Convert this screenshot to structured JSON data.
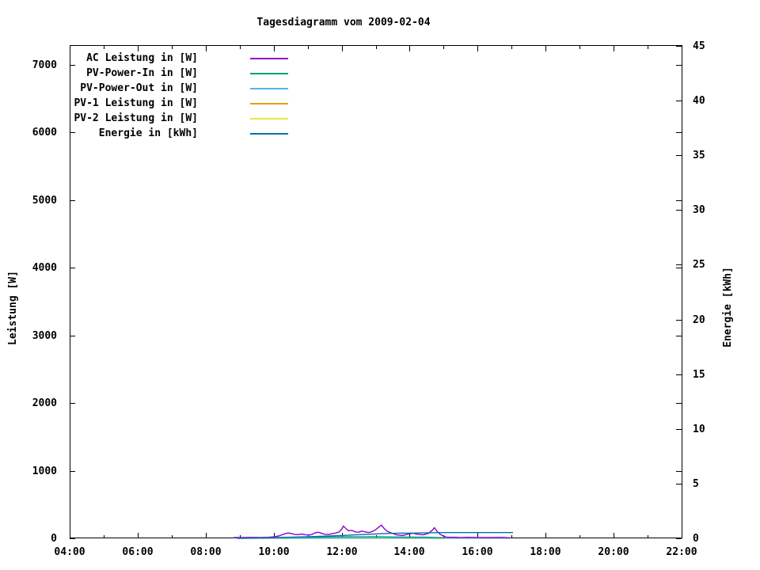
{
  "page": {
    "background": "#ffffff",
    "text_color": "#000000"
  },
  "chart_data": {
    "type": "line",
    "title": "Tagesdiagramm vom 2009-02-04",
    "ylabel_left": "Leistung [W]",
    "ylabel_right": "Energie [kWh]",
    "x_unit": "time HH:MM",
    "x_range_hours": [
      4,
      22
    ],
    "y_left_range": [
      0,
      7280
    ],
    "y_right_range": [
      0,
      45
    ],
    "grid": false,
    "legend_position": "top-left inside",
    "x_tick_hours": [
      4,
      6,
      8,
      10,
      12,
      14,
      16,
      18,
      20,
      22
    ],
    "x_tick_labels": [
      "04:00",
      "06:00",
      "08:00",
      "10:00",
      "12:00",
      "14:00",
      "16:00",
      "18:00",
      "20:00",
      "22:00"
    ],
    "x_minor_tick_hours": [
      5,
      7,
      9,
      11,
      13,
      15,
      17,
      19,
      21
    ],
    "y_left_ticks": [
      0,
      1000,
      2000,
      3000,
      4000,
      5000,
      6000,
      7000
    ],
    "y_right_ticks": [
      0,
      5,
      10,
      15,
      20,
      25,
      30,
      35,
      40,
      45
    ],
    "series": [
      {
        "name": "AC Leistung in [W]",
        "color": "#9400D3",
        "axis": "left",
        "points": [
          [
            8.83,
            12
          ],
          [
            9.1,
            12
          ],
          [
            9.35,
            14
          ],
          [
            9.6,
            13
          ],
          [
            9.85,
            15
          ],
          [
            10.0,
            22
          ],
          [
            10.15,
            35
          ],
          [
            10.3,
            62
          ],
          [
            10.42,
            80
          ],
          [
            10.52,
            70
          ],
          [
            10.62,
            57
          ],
          [
            10.72,
            55
          ],
          [
            10.82,
            63
          ],
          [
            10.92,
            55
          ],
          [
            11.02,
            49
          ],
          [
            11.12,
            56
          ],
          [
            11.22,
            82
          ],
          [
            11.32,
            90
          ],
          [
            11.42,
            72
          ],
          [
            11.52,
            60
          ],
          [
            11.62,
            57
          ],
          [
            11.72,
            68
          ],
          [
            11.82,
            79
          ],
          [
            11.92,
            93
          ],
          [
            12.0,
            135
          ],
          [
            12.05,
            182
          ],
          [
            12.12,
            148
          ],
          [
            12.2,
            112
          ],
          [
            12.3,
            118
          ],
          [
            12.4,
            96
          ],
          [
            12.5,
            90
          ],
          [
            12.6,
            108
          ],
          [
            12.7,
            94
          ],
          [
            12.8,
            86
          ],
          [
            12.9,
            101
          ],
          [
            13.0,
            128
          ],
          [
            13.1,
            168
          ],
          [
            13.17,
            196
          ],
          [
            13.25,
            146
          ],
          [
            13.33,
            108
          ],
          [
            13.42,
            88
          ],
          [
            13.5,
            72
          ],
          [
            13.6,
            54
          ],
          [
            13.7,
            46
          ],
          [
            13.8,
            42
          ],
          [
            13.9,
            56
          ],
          [
            14.0,
            66
          ],
          [
            14.1,
            76
          ],
          [
            14.2,
            62
          ],
          [
            14.3,
            56
          ],
          [
            14.4,
            52
          ],
          [
            14.55,
            72
          ],
          [
            14.68,
            126
          ],
          [
            14.73,
            158
          ],
          [
            14.8,
            106
          ],
          [
            14.9,
            58
          ],
          [
            15.0,
            32
          ],
          [
            15.1,
            15
          ],
          [
            15.3,
            16
          ],
          [
            15.5,
            13
          ],
          [
            15.7,
            15
          ],
          [
            15.9,
            14
          ],
          [
            16.1,
            13
          ],
          [
            16.35,
            12
          ],
          [
            16.6,
            14
          ],
          [
            16.8,
            13
          ],
          [
            16.95,
            6
          ]
        ]
      },
      {
        "name": "PV-Power-In in [W]",
        "color": "#009E73",
        "axis": "left",
        "points": [
          [
            8.92,
            4
          ],
          [
            9.3,
            6
          ],
          [
            9.7,
            9
          ],
          [
            10.0,
            12
          ],
          [
            10.5,
            16
          ],
          [
            11.0,
            18
          ],
          [
            11.5,
            20
          ],
          [
            12.0,
            24
          ],
          [
            12.5,
            22
          ],
          [
            13.0,
            24
          ],
          [
            13.5,
            20
          ],
          [
            14.0,
            18
          ],
          [
            14.5,
            16
          ],
          [
            14.9,
            10
          ],
          [
            15.05,
            5
          ]
        ]
      },
      {
        "name": "PV-Power-Out in [W]",
        "color": "#56B4E9",
        "axis": "left",
        "points": [
          [
            8.92,
            2
          ],
          [
            10.0,
            2
          ],
          [
            12.0,
            3
          ],
          [
            14.0,
            3
          ],
          [
            15.05,
            2
          ],
          [
            16.95,
            2
          ]
        ]
      },
      {
        "name": "PV-1 Leistung in [W]",
        "color": "#E69F00",
        "axis": "left",
        "points": [
          [
            8.92,
            1
          ],
          [
            16.95,
            1
          ]
        ]
      },
      {
        "name": "PV-2 Leistung in [W]",
        "color": "#F0E442",
        "axis": "left",
        "points": [
          [
            8.92,
            1
          ],
          [
            16.95,
            1
          ]
        ]
      },
      {
        "name": "Energie in [kWh]",
        "color": "#0072B2",
        "axis": "right",
        "points": [
          [
            8.92,
            0.0
          ],
          [
            9.5,
            0.02
          ],
          [
            10.0,
            0.05
          ],
          [
            10.4,
            0.09
          ],
          [
            10.8,
            0.13
          ],
          [
            11.2,
            0.17
          ],
          [
            11.6,
            0.21
          ],
          [
            12.0,
            0.26
          ],
          [
            12.4,
            0.32
          ],
          [
            12.8,
            0.37
          ],
          [
            13.2,
            0.43
          ],
          [
            13.6,
            0.46
          ],
          [
            14.0,
            0.48
          ],
          [
            14.4,
            0.5
          ],
          [
            14.8,
            0.52
          ],
          [
            15.2,
            0.53
          ],
          [
            16.0,
            0.53
          ],
          [
            17.04,
            0.53
          ]
        ]
      }
    ]
  }
}
